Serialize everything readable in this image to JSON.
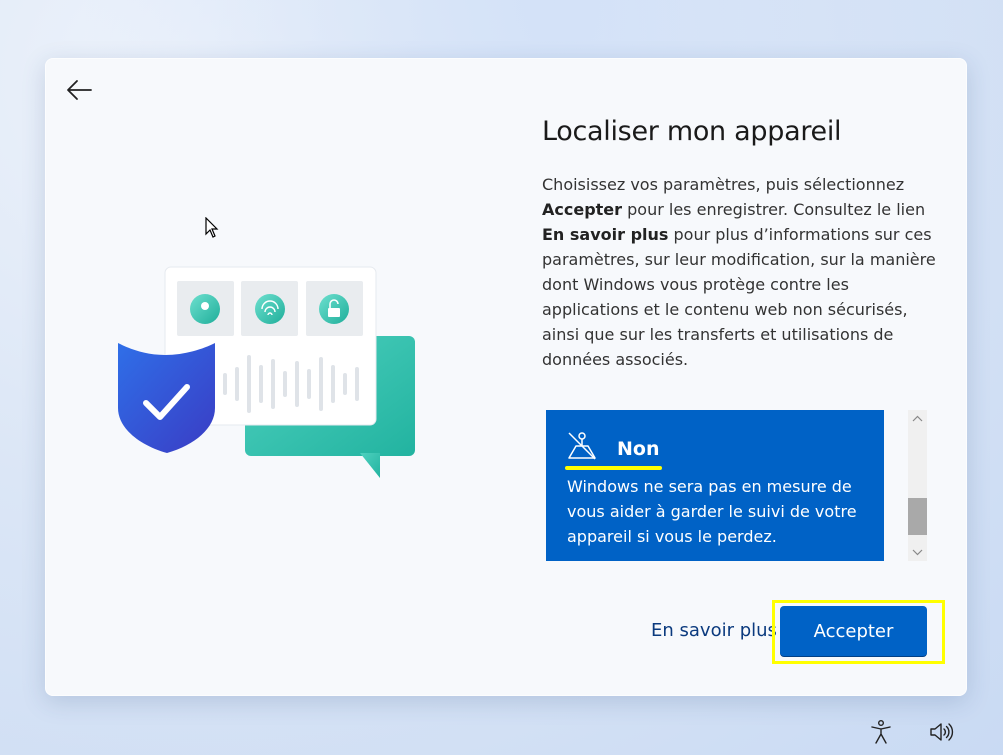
{
  "dialog": {
    "title": "Localiser mon appareil",
    "description": {
      "p1": "Choisissez vos paramètres, puis sélectionnez ",
      "b1": "Accepter",
      "p2": " pour les enregistrer. Consultez le lien ",
      "b2": "En savoir plus",
      "p3": " pour plus d’informations sur ces paramètres, sur leur modification, sur la manière dont Windows vous protège contre les applications et le contenu web non sécurisés, ainsi que sur les transferts et utilisations de données associés."
    },
    "option": {
      "title": "Non",
      "description": "Windows ne sera pas en mesure de vous aider à garder le suivi de votre appareil si vous le perdez."
    },
    "learn_more": "En savoir plus",
    "accept": "Accepter"
  },
  "icons": {
    "back": "back-arrow-icon",
    "location": "location-pin-icon",
    "fingerprint": "fingerprint-icon",
    "lock": "unlock-icon",
    "shield": "shield-check-icon",
    "option": "location-off-icon",
    "accessibility": "accessibility-icon",
    "volume": "volume-icon"
  },
  "colors": {
    "accent": "#0062c6",
    "highlight": "#ffff00",
    "teal": "#3cc3b0",
    "shield": "#2b4fd6"
  }
}
